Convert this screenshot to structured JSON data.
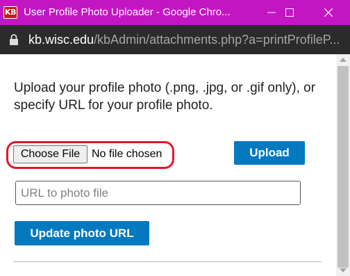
{
  "window": {
    "title": "User Profile Photo Uploader - Google Chro...",
    "app_icon_text": "KB",
    "title_bar_color": "#c316c3"
  },
  "address_bar": {
    "host": "kb.wisc.edu",
    "path": "/kbAdmin/attachments.php?a=printProfileP..."
  },
  "content": {
    "instruction": "Upload your profile photo (.png, .jpg, or .gif only), or specify URL for your profile photo.",
    "choose_file_label": "Choose File",
    "no_file_text": "No file chosen",
    "upload_label": "Upload",
    "url_placeholder": "URL to photo file",
    "update_label": "Update photo URL"
  },
  "colors": {
    "primary_button": "#0479bf",
    "highlight": "#e0162b"
  }
}
